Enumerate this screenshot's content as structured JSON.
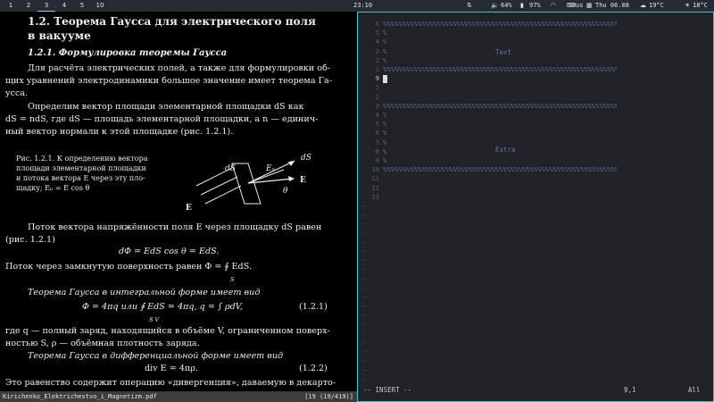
{
  "topbar": {
    "workspaces": [
      {
        "label": "1",
        "active": false
      },
      {
        "label": "2",
        "active": false
      },
      {
        "label": "3",
        "active": true
      },
      {
        "label": "4",
        "active": false
      },
      {
        "label": "5",
        "active": false
      },
      {
        "label": "10",
        "active": false
      }
    ],
    "clock": "23:10",
    "status": {
      "volume": "64%",
      "battery": "97%",
      "keyboard": "us",
      "date": "Thu 06.08",
      "temp1": "19°C",
      "temp2": "18°C"
    }
  },
  "pdf": {
    "section_title_1": "1.2. Теорема Гаусса для электрического поля",
    "section_title_2": "в вакууме",
    "subsection": "1.2.1. Формулировка теоремы Гаусса",
    "para1": [
      "Для расчёта электрических полей, а также для формулировки об-",
      "щих уравнений электродинамики большое значение имеет теорема Га-",
      "усса."
    ],
    "para2": [
      "Определим вектор площади элементарной площадки dS как",
      "dS = ndS, где dS — площадь элементарной площадки, а n — единич-",
      "ный вектор нормали к этой площадке (рис. 1.2.1)."
    ],
    "caption": [
      "Рис. 1.2.1. К определению вектора",
      "площади элементарной площадки",
      "и потока вектора E через эту пло-",
      "щадку; Eₙ = E cos θ"
    ],
    "figure_labels": {
      "ds_top": "dS",
      "ds_left": "dS",
      "en": "Eₙ",
      "e_right": "E",
      "theta": "θ",
      "e_left": "E"
    },
    "para3": [
      "Поток вектора напряжённости поля E через площадку dS равен",
      "(рис. 1.2.1)"
    ],
    "eq_flux": "dΦ = EdS cos θ = EdS.",
    "closed_flux": "Поток через замкнутую поверхность равен  Φ = ∮ EdS.",
    "closed_flux_sub": "S",
    "integral_form_label": "Теорема Гаусса в интегральной форме имеет вид",
    "eq_integral": "Φ = 4πq   или  ∮ EdS = 4πq,   q = ∫ ρdV,",
    "eq_integral_subs": "S                      V",
    "eq_integral_num": "(1.2.1)",
    "para4": [
      "где q — полный заряд, находящийся в объёме V, ограниченном поверх-",
      "ностью S, ρ — объёмная плотность заряда."
    ],
    "diff_form_label": "Теорема Гаусса в дифференциальной форме имеет вид",
    "eq_diff": "div E = 4πρ.",
    "eq_diff_num": "(1.2.2)",
    "para5": "Это равенство содержит операцию «дивергенция», даваемую в декарто-",
    "statusbar_file": "Kirichenko_Elektrichestvo_i_Magnetizm.pdf",
    "statusbar_page": "[19 (19/419)]"
  },
  "vim": {
    "lines": [
      {
        "num": "6",
        "text": "%%%%%%%%%%%%%%%%%%%%%%%%%%%%%%%%%%%%%%%%%%%%%%%%%%%%%%%%%%%%%%%%%%%%%%%%%%%%%%%%%%%%%%%%"
      },
      {
        "num": "5",
        "text": "%                                                                                      %"
      },
      {
        "num": "4",
        "text": "%                                                                                      %"
      },
      {
        "num": "3",
        "text": "%                                                                                      %"
      },
      {
        "num": "2",
        "text": "%                                                                                      %"
      },
      {
        "num": "1",
        "text": "%%%%%%%%%%%%%%%%%%%%%%%%%%%%%%%%%%%%%%%%%%%%%%%%%%%%%%%%%%%%%%%%%%%%%%%%%%%%%%%%%%%%%%%%"
      },
      {
        "num": "9",
        "text": ""
      },
      {
        "num": "1",
        "text": ""
      },
      {
        "num": "2",
        "text": ""
      },
      {
        "num": "3",
        "text": "%%%%%%%%%%%%%%%%%%%%%%%%%%%%%%%%%%%%%%%%%%%%%%%%%%%%%%%%%%%%%%%%%%%%%%%%%%%%%%%%%%%%%%%%"
      },
      {
        "num": "4",
        "text": "%                                                                                      %"
      },
      {
        "num": "5",
        "text": "%                                                                                      %"
      },
      {
        "num": "6",
        "text": "%                                                                                      %"
      },
      {
        "num": "7",
        "text": "%                                                                                      %"
      },
      {
        "num": "8",
        "text": "%                                                                                      %"
      },
      {
        "num": "9",
        "text": "%                                                                                      %"
      },
      {
        "num": "10",
        "text": "%%%%%%%%%%%%%%%%%%%%%%%%%%%%%%%%%%%%%%%%%%%%%%%%%%%%%%%%%%%%%%%%%%%%%%%%%%%%%%%%%%%%%%%%"
      },
      {
        "num": "11",
        "text": ""
      },
      {
        "num": "12",
        "text": ""
      },
      {
        "num": "13",
        "text": ""
      }
    ],
    "box1_text": "Text",
    "box2_text": "Extra",
    "mode": "-- INSERT --",
    "position": "9,1",
    "scroll": "All"
  }
}
